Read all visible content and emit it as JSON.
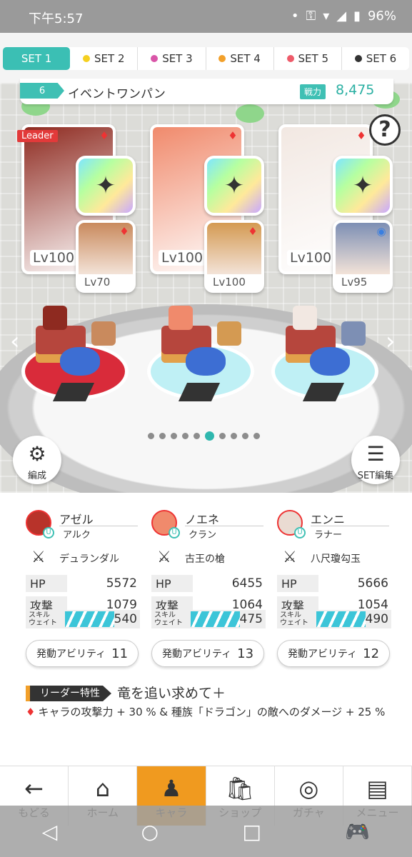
{
  "status": {
    "time": "下午5:57",
    "dot": "•",
    "battery": "96%"
  },
  "tabs": [
    {
      "label": "SET 1",
      "color": "#3bbfb4",
      "active": true
    },
    {
      "label": "SET 2",
      "color": "#f5d020"
    },
    {
      "label": "SET 3",
      "color": "#d955a8"
    },
    {
      "label": "SET 4",
      "color": "#f2a02a"
    },
    {
      "label": "SET 5",
      "color": "#ee5b6a"
    },
    {
      "label": "SET 6",
      "color": "#333333"
    }
  ],
  "party": {
    "number": "6",
    "name": "イベントワンパン",
    "power_label": "戦力",
    "power_value": "8,475"
  },
  "stage": {
    "leader": "Leader",
    "help": "?",
    "left_arrow": "‹",
    "right_arrow": "›",
    "form_label": "編成",
    "set_edit_label": "SET編集",
    "pager_total": 10,
    "pager_active": 5
  },
  "cards": [
    {
      "main_lv": "Lv100",
      "sub_lv": "Lv70",
      "art": "#8e2a20",
      "sub_art": "#c98a5d",
      "weapon_icon": "sword-icon"
    },
    {
      "main_lv": "Lv100",
      "sub_lv": "Lv100",
      "art": "#f08a6c",
      "sub_art": "#d49a52",
      "weapon_icon": "axe-icon"
    },
    {
      "main_lv": "Lv100",
      "sub_lv": "Lv95",
      "art": "#f2e8e2",
      "sub_art": "#7d8fb4",
      "weapon_icon": "jewel-icon"
    }
  ],
  "chars": [
    {
      "name": "アゼル",
      "guild": "アルク",
      "weapon": "デュランダル",
      "hp_label": "HP",
      "hp": "5572",
      "atk_label": "攻撃",
      "atk": "1079",
      "skill_label": "スキル\nウェイト",
      "skill": "540",
      "ability_label": "発動アビリティ",
      "ability": "11",
      "avatar_color": "#b8332a"
    },
    {
      "name": "ノエネ",
      "guild": "クラン",
      "weapon": "古王の槍",
      "hp_label": "HP",
      "hp": "6455",
      "atk_label": "攻撃",
      "atk": "1064",
      "skill_label": "スキル\nウェイト",
      "skill": "475",
      "ability_label": "発動アビリティ",
      "ability": "13",
      "avatar_color": "#f08a6c"
    },
    {
      "name": "エンニ",
      "guild": "ラナー",
      "weapon": "八尺瓊勾玉",
      "hp_label": "HP",
      "hp": "5666",
      "atk_label": "攻撃",
      "atk": "1054",
      "skill_label": "スキル\nウェイト",
      "skill": "490",
      "ability_label": "発動アビリティ",
      "ability": "12",
      "avatar_color": "#eadbd2"
    }
  ],
  "leader_skill": {
    "tag": "リーダー特性",
    "title": "竜を追い求めて＋",
    "desc": "キャラの攻撃力 + 30 % & 種族「ドラゴン」の敵へのダメージ + 25 %"
  },
  "nav": [
    {
      "label": "もどる",
      "icon": "back-arrow-icon"
    },
    {
      "label": "ホーム",
      "icon": "home-icon"
    },
    {
      "label": "キャラ",
      "icon": "chara-icon",
      "active": true
    },
    {
      "label": "ショップ",
      "icon": "shop-icon"
    },
    {
      "label": "ガチャ",
      "icon": "gacha-icon"
    },
    {
      "label": "メニュー",
      "icon": "menu-icon"
    }
  ]
}
